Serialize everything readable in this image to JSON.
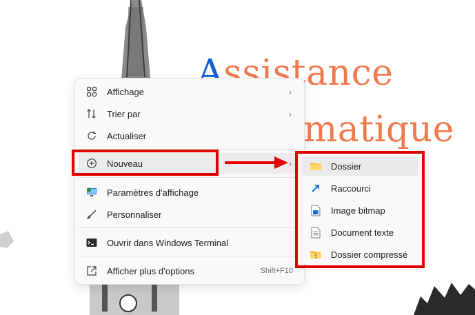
{
  "wallpaper": {
    "title_line1_first": "A",
    "title_line1_rest": "ssistance",
    "title_line2": "matique"
  },
  "menu": {
    "items": [
      {
        "label": "Affichage",
        "icon": "grid-view-icon",
        "chevron": "›"
      },
      {
        "label": "Trier par",
        "icon": "sort-icon",
        "chevron": "›"
      },
      {
        "label": "Actualiser",
        "icon": "refresh-icon"
      },
      {
        "label": "Nouveau",
        "icon": "add-circle-icon",
        "chevron": "›"
      },
      {
        "label": "Paramètres d'affichage",
        "icon": "display-settings-icon"
      },
      {
        "label": "Personnaliser",
        "icon": "brush-icon"
      },
      {
        "label": "Ouvrir dans Windows Terminal",
        "icon": "terminal-icon"
      },
      {
        "label": "Afficher plus d’options",
        "icon": "open-more-icon",
        "shortcut": "Shift+F10"
      }
    ]
  },
  "submenu": {
    "items": [
      {
        "label": "Dossier",
        "icon": "folder-icon"
      },
      {
        "label": "Raccourci",
        "icon": "shortcut-arrow-icon"
      },
      {
        "label": "Image bitmap",
        "icon": "bitmap-file-icon"
      },
      {
        "label": "Document texte",
        "icon": "text-document-icon"
      },
      {
        "label": "Dossier compressé",
        "icon": "zip-folder-icon"
      }
    ]
  },
  "colors": {
    "annotation_red": "#e00000",
    "title_orange": "#f07a4f",
    "title_blue": "#1060d8"
  }
}
